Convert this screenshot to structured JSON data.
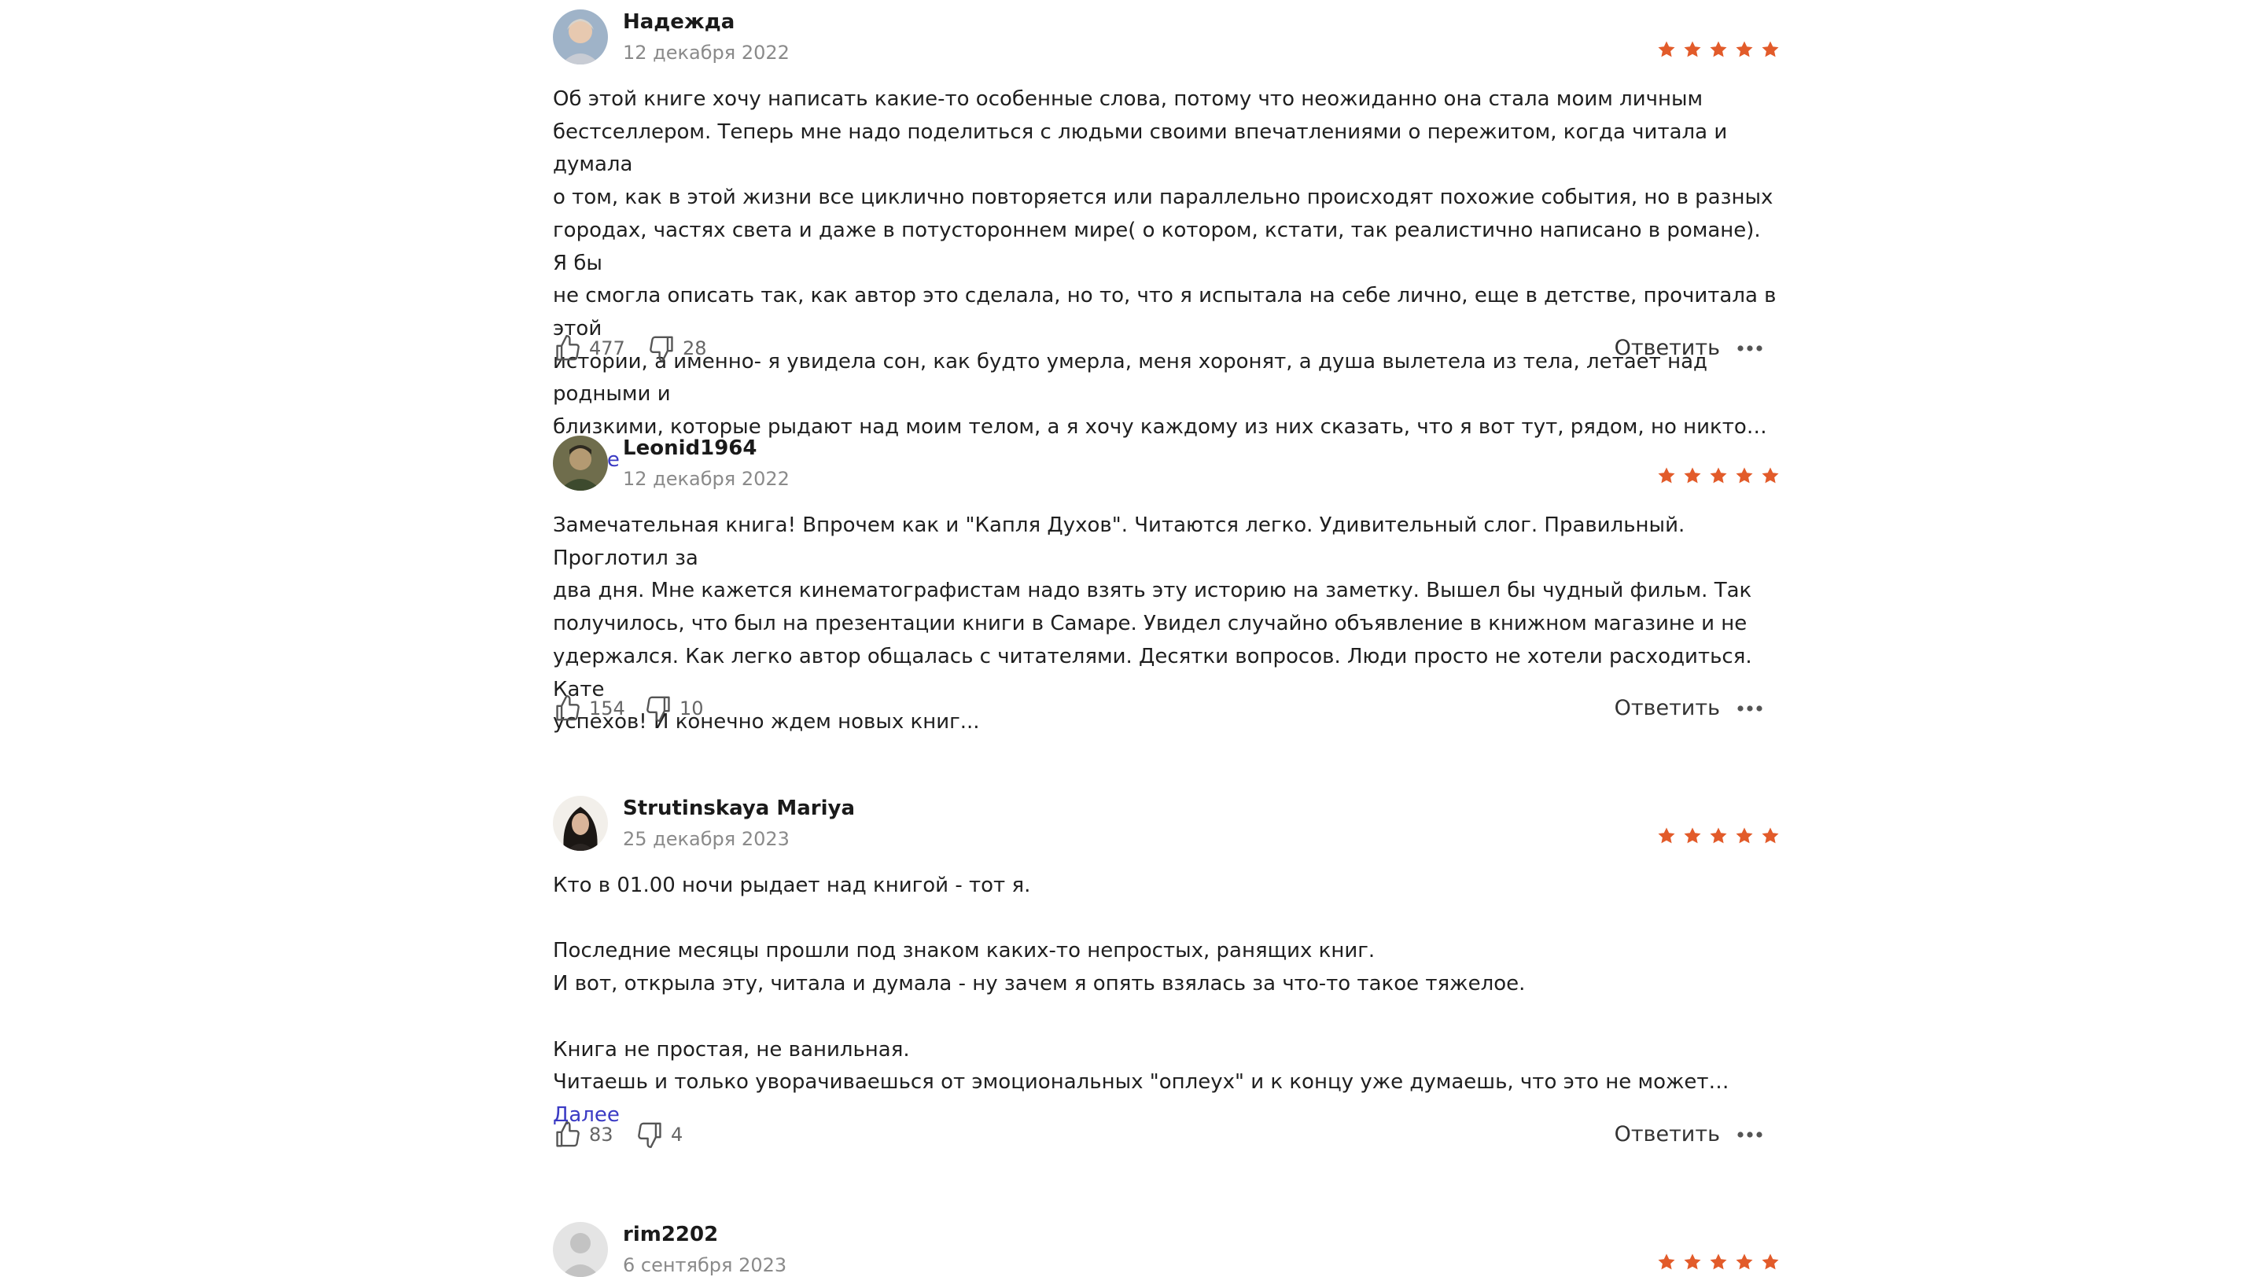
{
  "colors": {
    "star": "#e25b2a",
    "link": "#3b3bc4",
    "date": "#8a8a8a"
  },
  "reviews": [
    {
      "author": "Надежда",
      "date": "12 декабря 2022",
      "rating": 5,
      "text": "Об этой книге хочу написать какие-то особенные слова, потому что неожиданно она стала моим личным\nбестселлером. Теперь мне надо поделиться с людьми своими впечатлениями о пережитом, когда читала и думала\nо том, как в этой жизни все циклично повторяется или параллельно происходят похожие события, но в разных\nгородах, частях света и даже в потустороннем мире( о котором, кстати, так реалистично написано в романе). Я бы\nне смогла описать так, как автор это сделала, но то, что я испытала на себе лично, еще в детстве, прочитала в этой\nистории, а именно- я увидела сон, как будто умерла, меня хоронят, а душа вылетела из тела, летает над родными и\nблизкими, которые рыдают над моим телом, а я хочу каждому из них сказать, что я вот тут, рядом, но никто… ",
      "more": "Далее",
      "likes": "477",
      "dislikes": "28",
      "reply": "Ответить",
      "avatar": "avatar-photo-icon"
    },
    {
      "author": "Leonid1964",
      "date": "12 декабря 2022",
      "rating": 5,
      "text": "Замечательная книга! Впрочем как и \"Капля Духов\". Читаются легко. Удивительный слог. Правильный. Проглотил за\nдва дня. Мне кажется кинематографистам надо взять эту историю на заметку. Вышел бы чудный фильм. Так\nполучилось, что был на презентации книги в Самаре. Увидел случайно объявление в книжном магазине и не\nудержался. Как легко автор общалась с читателями. Десятки вопросов. Люди просто не хотели расходиться. Кате\nуспехов! И конечно ждем новых книг...",
      "more": "",
      "likes": "154",
      "dislikes": "10",
      "reply": "Ответить",
      "avatar": "avatar-photo-icon"
    },
    {
      "author": "Strutinskaya Mariya",
      "date": "25 декабря 2023",
      "rating": 5,
      "text": "Кто в 01.00 ночи рыдает над книгой - тот я.\n\nПоследние месяцы прошли под знаком каких-то непростых, ранящих книг.\nИ вот, открыла эту, читала и думала - ну зачем я опять взялась за что-то такое тяжелое.\n\nКнига не простая, не ванильная.\nЧитаешь и только уворачиваешься от эмоциональных \"оплеух\" и к концу уже думаешь, что это не может… ",
      "more": "Далее",
      "likes": "83",
      "dislikes": "4",
      "reply": "Ответить",
      "avatar": "avatar-photo-icon"
    },
    {
      "author": "rim2202",
      "date": "6 сентября 2023",
      "rating": 5,
      "avatar": "avatar-placeholder-icon"
    }
  ]
}
